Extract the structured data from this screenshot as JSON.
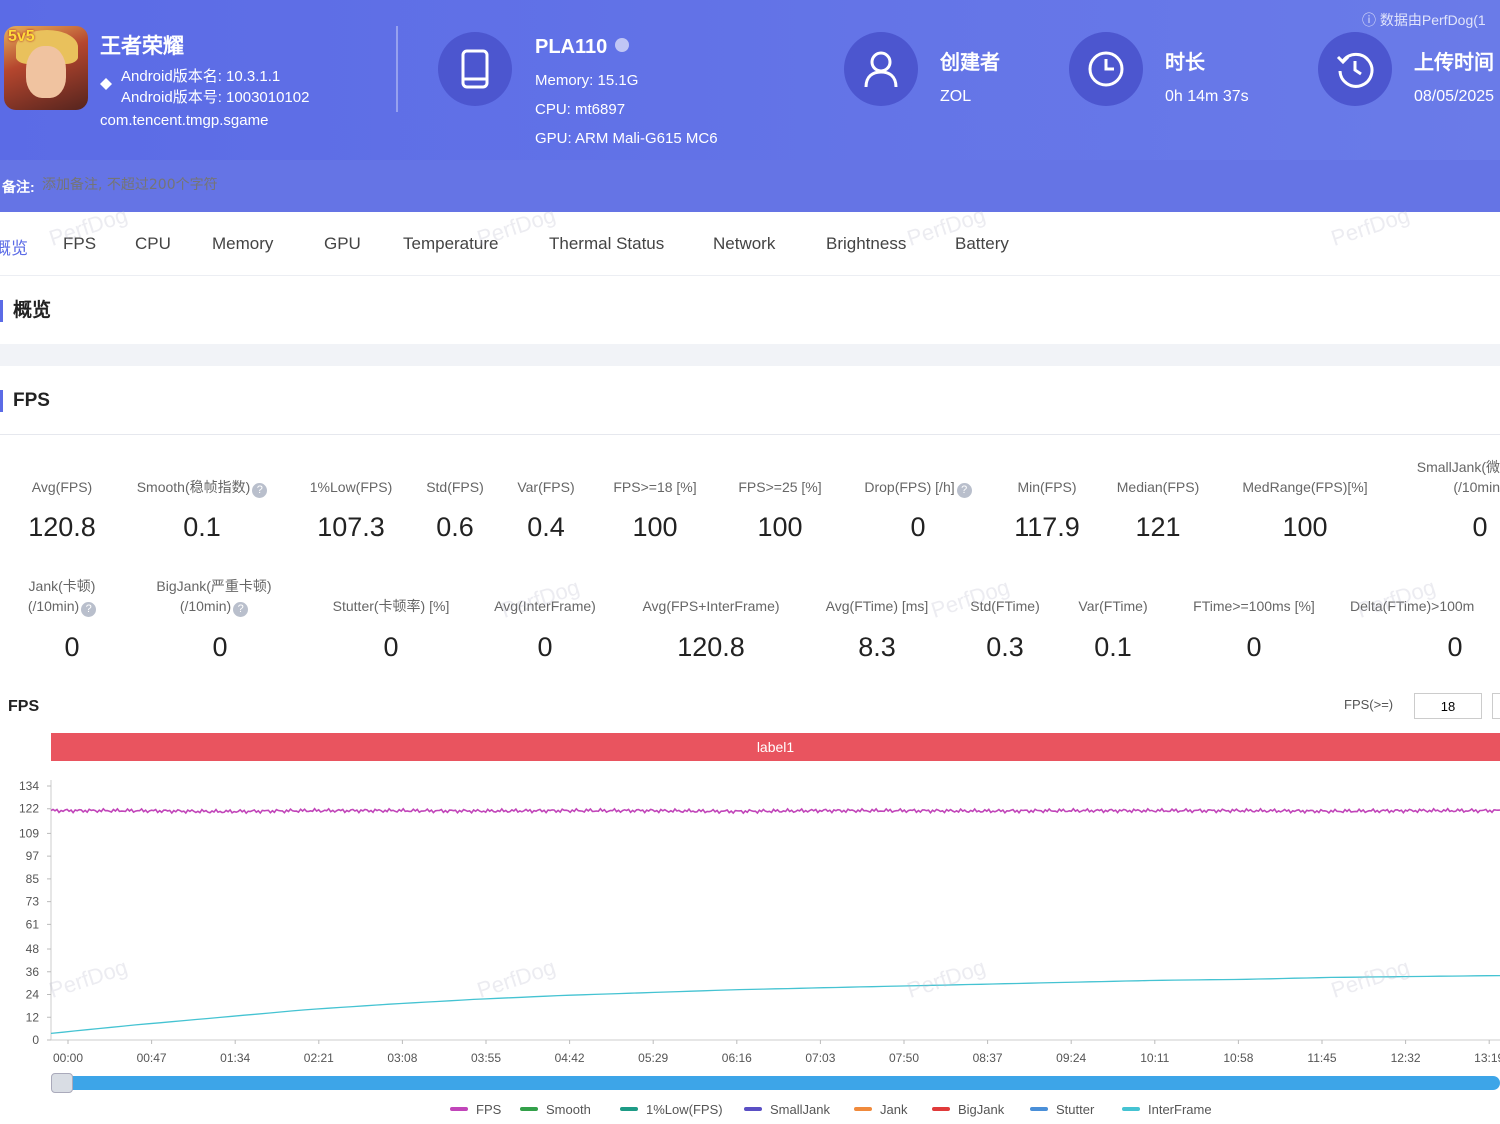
{
  "header": {
    "app_name": "王者荣耀",
    "android_version": "Android版本名: 10.3.1.1",
    "android_build": "Android版本号: 1003010102",
    "package": "com.tencent.tmgp.sgame",
    "app_badge": "5v5",
    "device_name": "PLA110",
    "memory": "Memory: 15.1G",
    "cpu": "CPU: mt6897",
    "gpu": "GPU: ARM Mali-G615 MC6",
    "creator_title": "创建者",
    "creator_value": "ZOL",
    "duration_title": "时长",
    "duration_value": "0h 14m 37s",
    "upload_title": "上传时间",
    "upload_value": "08/05/2025",
    "perfdog_note": "数据由PerfDog(1",
    "remark_label": "备注:",
    "remark_placeholder": "添加备注, 不超过200个字符",
    "accent_color": "#5b6be6"
  },
  "tabs": [
    "概览",
    "FPS",
    "CPU",
    "Memory",
    "GPU",
    "Temperature",
    "Thermal Status",
    "Network",
    "Brightness",
    "Battery"
  ],
  "overview_title": "概览",
  "fps_section_title": "FPS",
  "metrics_row1": [
    {
      "label": "Avg(FPS)",
      "value": "120.8"
    },
    {
      "label": "Smooth(稳帧指数)",
      "value": "0.1"
    },
    {
      "label": "1%Low(FPS)",
      "value": "107.3"
    },
    {
      "label": "Std(FPS)",
      "value": "0.6"
    },
    {
      "label": "Var(FPS)",
      "value": "0.4"
    },
    {
      "label": "FPS>=18 [%]",
      "value": "100"
    },
    {
      "label": "FPS>=25 [%]",
      "value": "100"
    },
    {
      "label": "Drop(FPS) [/h]",
      "value": "0"
    },
    {
      "label": "Min(FPS)",
      "value": "117.9"
    },
    {
      "label": "Median(FPS)",
      "value": "121"
    },
    {
      "label": "MedRange(FPS)[%]",
      "value": "100"
    },
    {
      "label": "SmallJank(微",
      "label2": "(/10min",
      "value": "0"
    }
  ],
  "metrics_row2": [
    {
      "label": "Jank(卡顿)",
      "label2": "(/10min)",
      "value": "0"
    },
    {
      "label": "BigJank(严重卡顿)",
      "label2": "(/10min)",
      "value": "0"
    },
    {
      "label": "Stutter(卡顿率) [%]",
      "value": "0"
    },
    {
      "label": "Avg(InterFrame)",
      "value": "0"
    },
    {
      "label": "Avg(FPS+InterFrame)",
      "value": "120.8"
    },
    {
      "label": "Avg(FTime) [ms]",
      "value": "8.3"
    },
    {
      "label": "Std(FTime)",
      "value": "0.3"
    },
    {
      "label": "Var(FTime)",
      "value": "0.1"
    },
    {
      "label": "FTime>=100ms [%]",
      "value": "0"
    },
    {
      "label": "Delta(FTime)>100m",
      "value": "0"
    }
  ],
  "chart": {
    "title": "FPS",
    "threshold_label": "FPS(>=)",
    "threshold_value": "18",
    "label_bar": "label1",
    "watermark": "PerfDog"
  },
  "chart_data": {
    "type": "line",
    "x_ticks": [
      "00:00",
      "00:47",
      "01:34",
      "02:21",
      "03:08",
      "03:55",
      "04:42",
      "05:29",
      "06:16",
      "07:03",
      "07:50",
      "08:37",
      "09:24",
      "10:11",
      "10:58",
      "11:45",
      "12:32",
      "13:19"
    ],
    "y_ticks": [
      0,
      12,
      24,
      36,
      48,
      61,
      73,
      85,
      97,
      109,
      122,
      134
    ],
    "ylim": [
      0,
      134
    ],
    "series": [
      {
        "name": "FPS",
        "color": "#c145b9",
        "values": [
          121,
          121,
          120.5,
          121,
          121,
          120.8,
          121,
          121,
          120.6,
          121,
          121,
          120.8,
          121,
          121,
          121,
          120.7,
          121,
          121
        ]
      },
      {
        "name": "InterFrame",
        "color": "#45c3d2",
        "values": [
          3.5,
          8,
          12,
          16,
          19,
          21.5,
          23.5,
          25,
          26.5,
          27.5,
          28.5,
          29.5,
          30.5,
          31.5,
          32,
          33,
          33.5,
          34
        ]
      }
    ],
    "legend": [
      {
        "name": "FPS",
        "color": "#c145b9"
      },
      {
        "name": "Smooth",
        "color": "#33a04a"
      },
      {
        "name": "1%Low(FPS)",
        "color": "#1e9b86"
      },
      {
        "name": "SmallJank",
        "color": "#5a4fc4"
      },
      {
        "name": "Jank",
        "color": "#f08a3c"
      },
      {
        "name": "BigJank",
        "color": "#e03a3a"
      },
      {
        "name": "Stutter",
        "color": "#4a8fd8"
      },
      {
        "name": "InterFrame",
        "color": "#45c3d2"
      }
    ]
  }
}
